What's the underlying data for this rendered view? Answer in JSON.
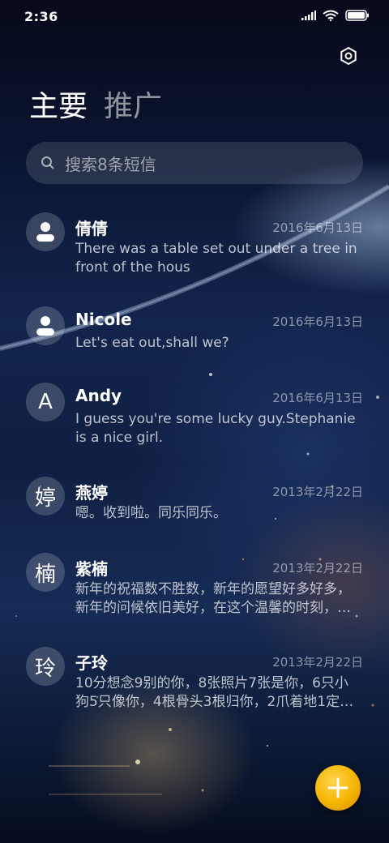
{
  "status_bar": {
    "time": "2:36",
    "icons": [
      "signal-icon",
      "wifi-icon",
      "battery-icon"
    ]
  },
  "header": {
    "settings_icon": "settings-icon"
  },
  "tabs": [
    {
      "label": "主要",
      "active": true
    },
    {
      "label": "推广",
      "active": false
    }
  ],
  "search": {
    "placeholder": "搜索8条短信"
  },
  "conversations": [
    {
      "avatar": "person-icon",
      "name": "倩倩",
      "date": "2016年6月13日",
      "preview": "There was a table set out under a tree in front of the hous"
    },
    {
      "avatar": "person-icon",
      "name": "Nicole",
      "date": "2016年6月13日",
      "preview": "Let's eat out,shall we?"
    },
    {
      "avatar": "A",
      "name": "Andy",
      "date": "2016年6月13日",
      "preview": "I guess you're some lucky guy.Stephanie is a nice girl."
    },
    {
      "avatar": "婷",
      "name": "燕婷",
      "date": "2013年2月22日",
      "preview": "嗯。收到啦。同乐同乐。"
    },
    {
      "avatar": "楠",
      "name": "紫楠",
      "date": "2013年2月22日",
      "preview": "新年的祝福数不胜数，新年的愿望好多好多，新年的问候依旧美好，在这个温馨的时刻，…"
    },
    {
      "avatar": "玲",
      "name": "子玲",
      "date": "2013年2月22日",
      "preview": "10分想念9别的你，8张照片7张是你，6只小狗5只像你，4根骨头3根归你，2爪着地1定…"
    }
  ],
  "fab": {
    "icon": "plus-icon",
    "color": "#f5b400"
  }
}
